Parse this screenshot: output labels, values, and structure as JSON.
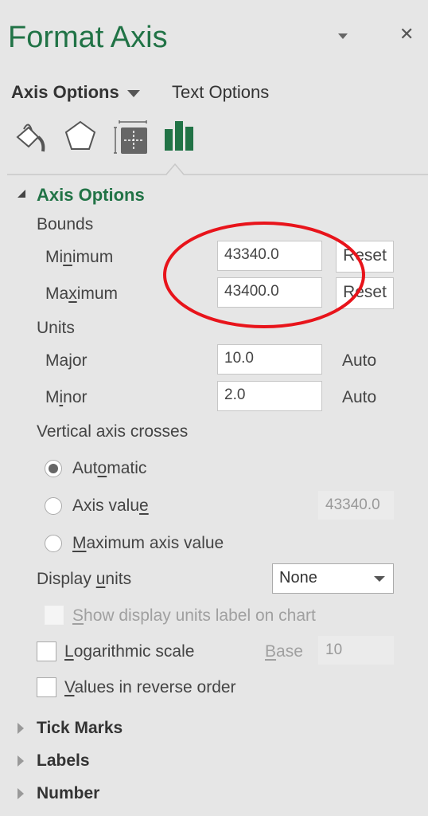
{
  "title": "Format Axis",
  "tabs": {
    "axis_options": "Axis Options",
    "text_options": "Text Options"
  },
  "icons": [
    "fill-line-icon",
    "effects-icon",
    "size-properties-icon",
    "axis-options-icon"
  ],
  "accent": "#217346",
  "section": {
    "title": "Axis Options",
    "bounds": "Bounds",
    "minimum": {
      "pre": "Mi",
      "acc": "n",
      "post": "imum",
      "value": "43340.0",
      "button": "Reset"
    },
    "maximum": {
      "pre": "Ma",
      "acc": "x",
      "post": "imum",
      "value": "43400.0",
      "button": "Reset"
    },
    "units": "Units",
    "major": {
      "pre": "Ma",
      "acc": "j",
      "post": "or",
      "value": "10.0",
      "auto": "Auto"
    },
    "minor": {
      "pre": "M",
      "acc": "i",
      "post": "nor",
      "value": "2.0",
      "auto": "Auto"
    },
    "crosses": "Vertical axis crosses",
    "automatic": {
      "pre": "Aut",
      "acc": "o",
      "post": "matic",
      "selected": true
    },
    "axis_value": {
      "pre": "Axis valu",
      "acc": "e",
      "post": "",
      "value": "43340.0",
      "selected": false
    },
    "max_axis_value": {
      "pre": "",
      "acc": "M",
      "post": "aximum axis value",
      "selected": false
    },
    "display_units": {
      "pre": "Display ",
      "acc": "u",
      "post": "nits",
      "value": "None"
    },
    "show_units_label": {
      "pre": "",
      "acc": "S",
      "post": "how display units label on chart",
      "checked": false
    },
    "log_scale": {
      "pre": "",
      "acc": "L",
      "post": "ogarithmic scale",
      "checked": false,
      "base_pre": "",
      "base_acc": "B",
      "base_post": "ase",
      "base_value": "10"
    },
    "reverse": {
      "pre": "",
      "acc": "V",
      "post": "alues in reverse order",
      "checked": false
    }
  },
  "collapsed": [
    "Tick Marks",
    "Labels",
    "Number"
  ],
  "annotation_color": "#e8141b"
}
